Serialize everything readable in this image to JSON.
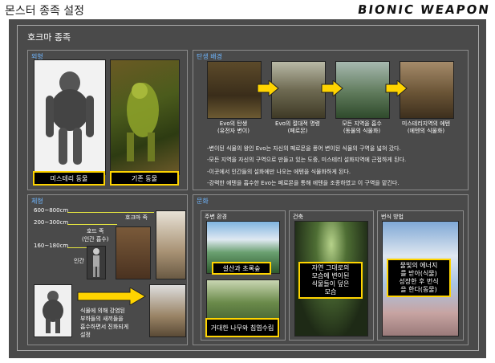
{
  "header": {
    "title": "몬스터 종족 설정",
    "logo": "BIONIC WEAPON"
  },
  "section": {
    "title": "호크마 종족"
  },
  "appearance": {
    "label": "외형",
    "captions": [
      "미스테리 동물",
      "기존 동물"
    ]
  },
  "birth": {
    "label": "탄생 배경",
    "stages": [
      {
        "line1": "Evo의 탄생",
        "line2": "(유전자 변이)"
      },
      {
        "line1": "Evo의 절대적 명령",
        "line2": "(페로몬)"
      },
      {
        "line1": "모든 지역을 흡수",
        "line2": "(동물의 식물화)"
      },
      {
        "line1": "미스테리지역의 에텐",
        "line2": "(에텐의 식물화)"
      }
    ],
    "bullets": [
      "-변이된 식물의 왕인 Evo는 자신의 페로몬을 풍어 변이된 식물의 구역을 넓혀 갔다.",
      "-모든 지역을 자신의 구역으로 만들고 있는 도중, 미스테리 설화지역에 근접하게 된다.",
      "-이곳에서 인간들의 설화에만 나오는 에텐을 식물화하게 된다.",
      "-강력한 에텐을 흡수한 Evo는 페로몬을 통해 에텐을 조종하였고 이 구역을 맡긴다."
    ]
  },
  "body_type": {
    "label": "체형",
    "heights": [
      "600~800cm",
      "200~300cm",
      "160~180cm"
    ],
    "names": {
      "hokma": "호크마 족",
      "hord_line1": "호드 족",
      "hord_line2": "(인간 흡수)",
      "human": "인간"
    },
    "evolution_text": [
      "식물에 의해 강염된",
      "부하들의 새끼들을",
      "흡수하면서 진화되게",
      "설정"
    ]
  },
  "culture": {
    "label": "문화",
    "surroundings": {
      "label": "주변 환경",
      "captions": [
        "설산과 초록숲",
        "거대한 나무와 침엽수림"
      ]
    },
    "architecture": {
      "label": "건축",
      "caption": [
        "자연 그대로의",
        "모습에 변이된",
        "식물들이 덮은",
        "모습"
      ]
    },
    "breeding": {
      "label": "번식 방법",
      "caption": [
        "물빛의 에너지",
        "를 받아(식물)",
        "성장한 후 번식",
        "을 한다(동물)"
      ]
    }
  },
  "colors": {
    "accent": "#ffd400",
    "label_blue": "#6fb6ff",
    "panel_bg": "#4a4a4a"
  }
}
